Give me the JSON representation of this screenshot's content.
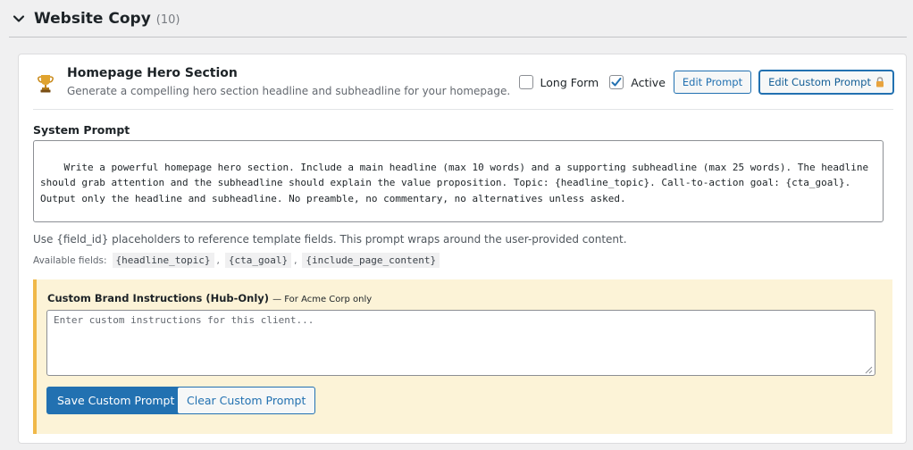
{
  "section": {
    "title": "Website Copy",
    "count": "(10)"
  },
  "item": {
    "title": "Homepage Hero Section",
    "description": "Generate a compelling hero section headline and subheadline for your homepage.",
    "long_form_label": "Long Form",
    "long_form_checked": false,
    "active_label": "Active",
    "active_checked": true,
    "edit_prompt_label": "Edit Prompt",
    "edit_custom_prompt_label": "Edit Custom Prompt"
  },
  "system_prompt": {
    "label": "System Prompt",
    "value": "Write a powerful homepage hero section. Include a main headline (max 10 words) and a supporting subheadline (max 25 words). The headline\nshould grab attention and the subheadline should explain the value proposition. Topic: {headline_topic}. Call-to-action goal: {cta_goal}.\nOutput only the headline and subheadline. No preamble, no commentary, no alternatives unless asked.",
    "help": "Use {field_id} placeholders to reference template fields. This prompt wraps around the user-provided content.",
    "available_label": "Available fields:",
    "fields": [
      "{headline_topic}",
      "{cta_goal}",
      "{include_page_content}"
    ]
  },
  "brand": {
    "title": "Custom Brand Instructions (Hub-Only)",
    "subtitle": "— For Acme Corp only",
    "placeholder": "Enter custom instructions for this client...",
    "save_label": "Save Custom Prompt",
    "clear_label": "Clear Custom Prompt"
  },
  "colors": {
    "accent": "#2271b1",
    "notice_bg": "#fcf3d7",
    "notice_border": "#f0b849"
  }
}
